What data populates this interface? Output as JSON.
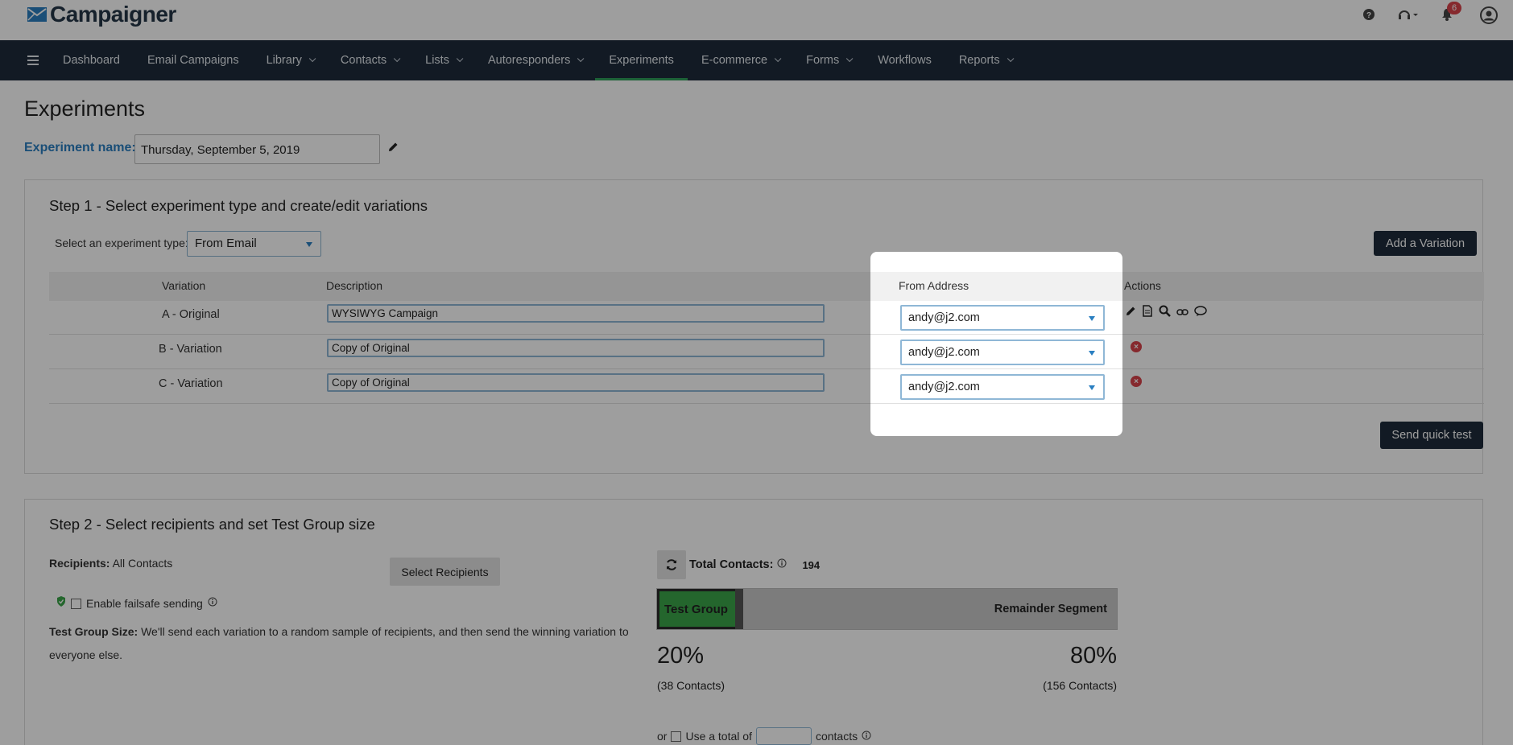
{
  "app": {
    "name": "Campaigner",
    "notification_count": "6"
  },
  "nav": {
    "items": [
      "Dashboard",
      "Email Campaigns",
      "Library",
      "Contacts",
      "Lists",
      "Autoresponders",
      "Experiments",
      "E-commerce",
      "Forms",
      "Workflows",
      "Reports"
    ]
  },
  "page": {
    "title": "Experiments",
    "experiment_name_label": "Experiment name:",
    "experiment_name_value": "Thursday, September 5, 2019"
  },
  "step1": {
    "title": "Step 1 - Select experiment type and create/edit variations",
    "type_label": "Select an experiment type:",
    "type_value": "From Email",
    "add_variation": "Add a Variation",
    "columns": {
      "variation": "Variation",
      "description": "Description",
      "from_address": "From Address",
      "actions": "Actions"
    },
    "rows": [
      {
        "variation": "A - Original",
        "description": "WYSIWYG Campaign",
        "from": "andy@j2.com"
      },
      {
        "variation": "B - Variation",
        "description": "Copy of Original",
        "from": "andy@j2.com"
      },
      {
        "variation": "C - Variation",
        "description": "Copy of Original",
        "from": "andy@j2.com"
      }
    ],
    "send_quick_test": "Send quick test"
  },
  "step2": {
    "title": "Step 2 - Select recipients and set Test Group size",
    "recipients_label": "Recipients:",
    "recipients_value": "All Contacts",
    "select_recipients": "Select Recipients",
    "failsafe_label": "Enable failsafe sending",
    "test_group_size_label": "Test Group Size:",
    "test_group_size_text": "We'll send each variation to a random sample of recipients, and then send the winning variation to everyone else.",
    "total_contacts_label": "Total Contacts:",
    "total_contacts_value": "194",
    "test_group_label": "Test Group",
    "remainder_label": "Remainder Segment",
    "test_group_fraction": 0.2,
    "test_pct": "20%",
    "test_contacts": "(38 Contacts)",
    "remainder_pct": "80%",
    "remainder_contacts": "(156 Contacts)",
    "or_text": "or",
    "use_total_label": "Use a total of",
    "contacts_suffix": "contacts"
  },
  "colors": {
    "navbar": "#1d2b3a",
    "accent_blue": "#2a7fc1",
    "test_group_green": "#3aa54a",
    "delete_red": "#d9434b",
    "active_tab_underline": "#2f9f5a"
  }
}
